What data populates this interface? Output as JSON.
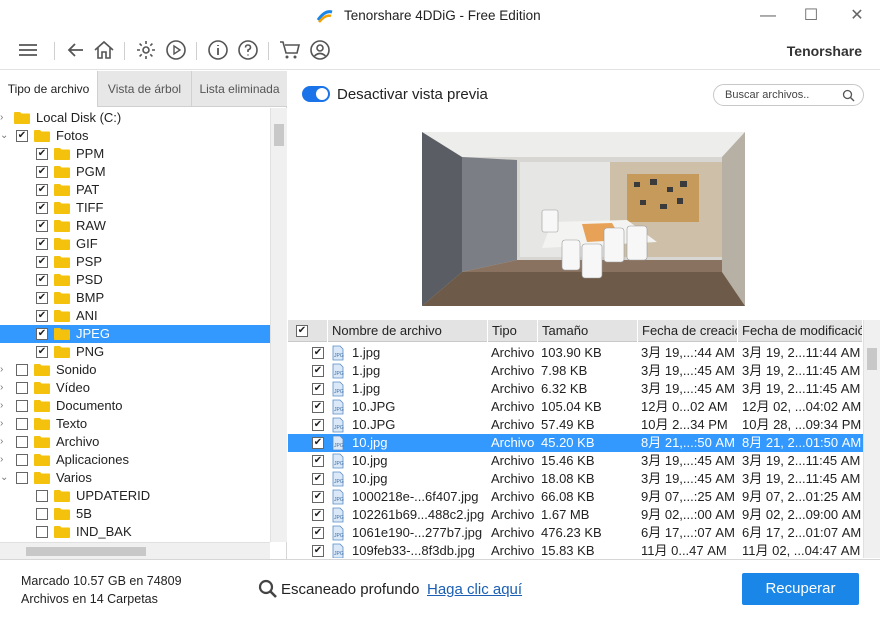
{
  "window": {
    "title": "Tenorshare 4DDiG - Free Edition",
    "minimize": "—",
    "maximize": "☐",
    "close": "✕"
  },
  "toolbar": {
    "brand": "Tenorshare"
  },
  "tabs": [
    "Tipo de archivo",
    "Vista de árbol",
    "Lista eliminada"
  ],
  "tree": [
    {
      "label": "Local Disk (C:)",
      "level": 0,
      "checkbox": false,
      "expander": "›"
    },
    {
      "label": "Fotos",
      "level": 1,
      "checked": true,
      "expander": "⌄"
    },
    {
      "label": "PPM",
      "level": 2,
      "checked": true
    },
    {
      "label": "PGM",
      "level": 2,
      "checked": true
    },
    {
      "label": "PAT",
      "level": 2,
      "checked": true
    },
    {
      "label": "TIFF",
      "level": 2,
      "checked": true
    },
    {
      "label": "RAW",
      "level": 2,
      "checked": true
    },
    {
      "label": "GIF",
      "level": 2,
      "checked": true
    },
    {
      "label": "PSP",
      "level": 2,
      "checked": true
    },
    {
      "label": "PSD",
      "level": 2,
      "checked": true
    },
    {
      "label": "BMP",
      "level": 2,
      "checked": true
    },
    {
      "label": "ANI",
      "level": 2,
      "checked": true
    },
    {
      "label": "JPEG",
      "level": 2,
      "checked": true,
      "selected": true
    },
    {
      "label": "PNG",
      "level": 2,
      "checked": true
    },
    {
      "label": "Sonido",
      "level": 1,
      "checked": false,
      "expander": "›"
    },
    {
      "label": "Vídeo",
      "level": 1,
      "checked": false,
      "expander": "›"
    },
    {
      "label": "Documento",
      "level": 1,
      "checked": false,
      "expander": "›"
    },
    {
      "label": "Texto",
      "level": 1,
      "checked": false,
      "expander": "›"
    },
    {
      "label": "Archivo",
      "level": 1,
      "checked": false,
      "expander": "›"
    },
    {
      "label": "Aplicaciones",
      "level": 1,
      "checked": false,
      "expander": "›"
    },
    {
      "label": "Varios",
      "level": 1,
      "checked": false,
      "expander": "⌄"
    },
    {
      "label": "UPDATERID",
      "level": 2,
      "checked": false
    },
    {
      "label": "5B",
      "level": 2,
      "checked": false
    },
    {
      "label": "IND_BAK",
      "level": 2,
      "checked": false
    }
  ],
  "preview_toggle": {
    "label": "Desactivar vista previa",
    "on": true
  },
  "search": {
    "placeholder": "Buscar archivos.."
  },
  "table": {
    "headers": [
      "Nombre de archivo",
      "Tipo",
      "Tamaño",
      "Fecha de creación",
      "Fecha de modificación"
    ],
    "rows": [
      {
        "name": "1.jpg",
        "type": "Archivo",
        "size": "103.90 KB",
        "created": "3月 19,...:44 AM",
        "modified": "3月 19, 2...11:44 AM",
        "checked": true
      },
      {
        "name": "1.jpg",
        "type": "Archivo",
        "size": "7.98 KB",
        "created": "3月 19,...:45 AM",
        "modified": "3月 19, 2...11:45 AM",
        "checked": true
      },
      {
        "name": "1.jpg",
        "type": "Archivo",
        "size": "6.32 KB",
        "created": "3月 19,...:45 AM",
        "modified": "3月 19, 2...11:45 AM",
        "checked": true
      },
      {
        "name": "10.JPG",
        "type": "Archivo",
        "size": "105.04 KB",
        "created": "12月 0...02 AM",
        "modified": "12月 02, ...04:02 AM",
        "checked": true
      },
      {
        "name": "10.JPG",
        "type": "Archivo",
        "size": "57.49 KB",
        "created": "10月 2...34 PM",
        "modified": "10月 28, ...09:34 PM",
        "checked": true
      },
      {
        "name": "10.jpg",
        "type": "Archivo",
        "size": "45.20 KB",
        "created": "8月 21,...:50 AM",
        "modified": "8月 21, 2...01:50 AM",
        "checked": true,
        "selected": true
      },
      {
        "name": "10.jpg",
        "type": "Archivo",
        "size": "15.46 KB",
        "created": "3月 19,...:45 AM",
        "modified": "3月 19, 2...11:45 AM",
        "checked": true
      },
      {
        "name": "10.jpg",
        "type": "Archivo",
        "size": "18.08 KB",
        "created": "3月 19,...:45 AM",
        "modified": "3月 19, 2...11:45 AM",
        "checked": true
      },
      {
        "name": "1000218e-...6f407.jpg",
        "type": "Archivo",
        "size": "66.08 KB",
        "created": "9月 07,...:25 AM",
        "modified": "9月 07, 2...01:25 AM",
        "checked": true
      },
      {
        "name": "102261b69...488c2.jpg",
        "type": "Archivo",
        "size": "1.67 MB",
        "created": "9月 02,...:00 AM",
        "modified": "9月 02, 2...09:00 AM",
        "checked": true
      },
      {
        "name": "1061e190-...277b7.jpg",
        "type": "Archivo",
        "size": "476.23 KB",
        "created": "6月 17,...:07 AM",
        "modified": "6月 17, 2...01:07 AM",
        "checked": true
      },
      {
        "name": "109feb33-...8f3db.jpg",
        "type": "Archivo",
        "size": "15.83 KB",
        "created": "11月 0...47 AM",
        "modified": "11月 02, ...04:47 AM",
        "checked": true
      }
    ]
  },
  "footer": {
    "status_line1": "Marcado 10.57 GB en 74809",
    "status_line2": "Archivos en 14 Carpetas",
    "deep_scan_label": "Escaneado profundo",
    "deep_scan_link": "Haga clic aquí",
    "recover_button": "Recuperar"
  },
  "colors": {
    "accent": "#1a86e8",
    "selection": "#3399ff",
    "folder": "#f4c20d"
  },
  "icons": [
    "menu-icon",
    "back-icon",
    "home-icon",
    "settings-icon",
    "play-icon",
    "info-icon",
    "help-icon",
    "cart-icon",
    "account-icon",
    "search-icon"
  ]
}
